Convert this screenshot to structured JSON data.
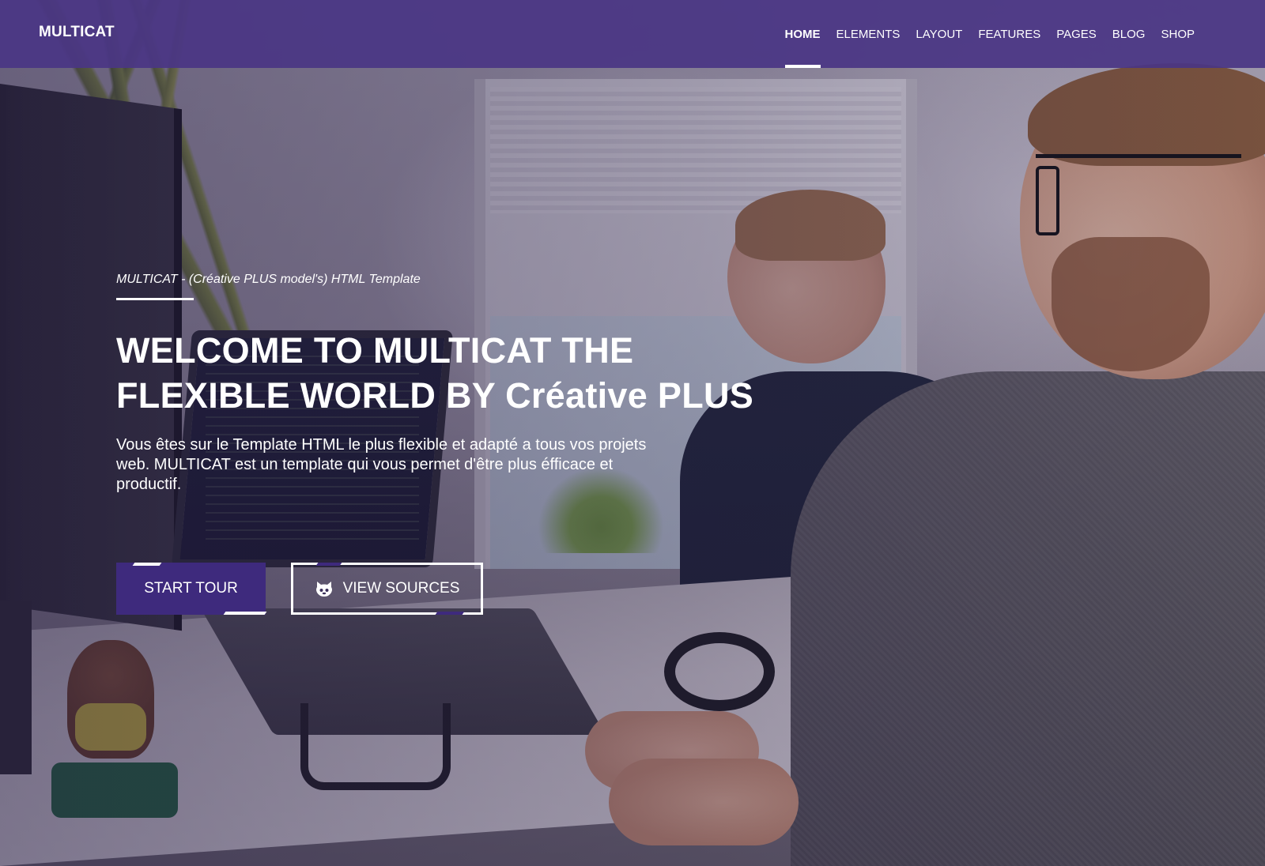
{
  "navbar": {
    "brand": "MULTICAT",
    "items": [
      {
        "label": "HOME",
        "active": true
      },
      {
        "label": "ELEMENTS",
        "active": false
      },
      {
        "label": "LAYOUT",
        "active": false
      },
      {
        "label": "FEATURES",
        "active": false
      },
      {
        "label": "PAGES",
        "active": false
      },
      {
        "label": "BLOG",
        "active": false
      },
      {
        "label": "SHOP",
        "active": false
      }
    ]
  },
  "hero": {
    "tagline": "MULTICAT - (Créative PLUS model's) HTML Template",
    "title": "WELCOME TO MULTICAT THE FLEXIBLE WORLD BY Créative PLUS",
    "description": "Vous êtes sur le Template HTML le plus flexible et adapté a tous vos projets web. MULTICAT est un template qui vous permet d'être plus éfficace et productif.",
    "buttons": {
      "start_tour": "START TOUR",
      "view_sources": "VIEW SOURCES",
      "view_sources_icon": "github-icon"
    }
  },
  "colors": {
    "navbar": "#4a3684",
    "primary_button": "#3e2a7d",
    "text": "#ffffff"
  }
}
